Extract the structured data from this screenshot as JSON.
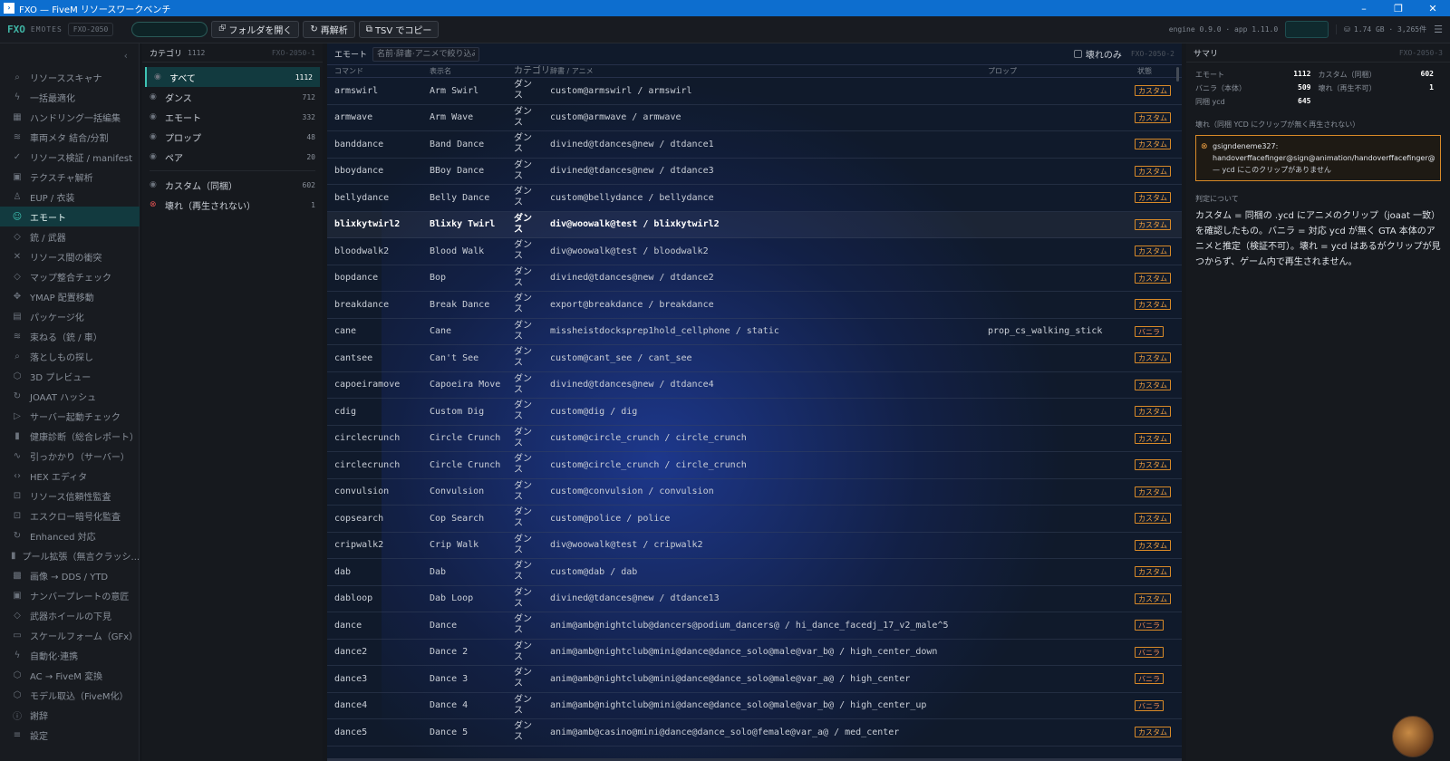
{
  "window": {
    "title": "FXO — FiveM リソースワークベンチ"
  },
  "toolbar": {
    "brand": "FXO",
    "section": "EMOTES",
    "code": "FXO-2050",
    "open_folder": "フォルダを開く",
    "reanalyze": "再解析",
    "copy_tsv": "TSV でコピー",
    "version": "engine 0.9.0 · app 1.11.0",
    "storage": "1.74 GB · 3,265件"
  },
  "sidebar": {
    "items": [
      {
        "label": "リソーススキャナ",
        "icon": "search-icon"
      },
      {
        "label": "一括最適化",
        "icon": "bolt-icon"
      },
      {
        "label": "ハンドリング一括編集",
        "icon": "grid-icon"
      },
      {
        "label": "車両メタ 結合/分割",
        "icon": "layers-icon"
      },
      {
        "label": "リソース検証 / manifest",
        "icon": "check-circle-icon"
      },
      {
        "label": "テクスチャ解析",
        "icon": "image-icon"
      },
      {
        "label": "EUP / 衣装",
        "icon": "user-icon"
      },
      {
        "label": "エモート",
        "icon": "emote-icon"
      },
      {
        "label": "銃 / 武器",
        "icon": "diamond-icon"
      },
      {
        "label": "リソース間の衝突",
        "icon": "cross-icon"
      },
      {
        "label": "マップ整合チェック",
        "icon": "diamond-icon"
      },
      {
        "label": "YMAP 配置移動",
        "icon": "move-icon"
      },
      {
        "label": "パッケージ化",
        "icon": "package-icon"
      },
      {
        "label": "束ねる（銃 / 車）",
        "icon": "layers-icon"
      },
      {
        "label": "落としもの探し",
        "icon": "search-icon"
      },
      {
        "label": "3D プレビュー",
        "icon": "cube-icon"
      },
      {
        "label": "JOAAT ハッシュ",
        "icon": "refresh-icon"
      },
      {
        "label": "サーバー起動チェック",
        "icon": "play-icon"
      },
      {
        "label": "健康診断（総合レポート）",
        "icon": "bar-chart-icon"
      },
      {
        "label": "引っかかり（サーバー）",
        "icon": "pulse-icon"
      },
      {
        "label": "HEX エディタ",
        "icon": "code-icon"
      },
      {
        "label": "リソース信頼性監査",
        "icon": "lock-icon"
      },
      {
        "label": "エスクロー暗号化監査",
        "icon": "lock-icon"
      },
      {
        "label": "Enhanced 対応",
        "icon": "refresh-icon"
      },
      {
        "label": "プール拡張（無言クラッシ...",
        "icon": "bar-chart-icon"
      },
      {
        "label": "画像 → DDS / YTD",
        "icon": "checker-icon"
      },
      {
        "label": "ナンバープレートの意匠",
        "icon": "image-icon"
      },
      {
        "label": "武器ホイールの下見",
        "icon": "diamond-icon"
      },
      {
        "label": "スケールフォーム（GFx）",
        "icon": "monitor-icon"
      },
      {
        "label": "自動化·連携",
        "icon": "bolt-icon"
      },
      {
        "label": "AC → FiveM 変換",
        "icon": "cube-icon"
      },
      {
        "label": "モデル取込（FiveM化）",
        "icon": "cube-icon"
      },
      {
        "label": "謝辞",
        "icon": "info-icon"
      },
      {
        "label": "設定",
        "icon": "sliders-icon"
      }
    ]
  },
  "categories": {
    "title": "カテゴリ",
    "count": "1112",
    "code": "FXO-2050-1",
    "items": [
      {
        "label": "すべて",
        "count": "1112"
      },
      {
        "label": "ダンス",
        "count": "712"
      },
      {
        "label": "エモート",
        "count": "332"
      },
      {
        "label": "プロップ",
        "count": "48"
      },
      {
        "label": "ペア",
        "count": "20"
      }
    ],
    "extra": [
      {
        "label": "カスタム（同梱）",
        "count": "602"
      },
      {
        "label": "壊れ（再生されない）",
        "count": "1"
      }
    ]
  },
  "emotes": {
    "title": "エモート",
    "filter_placeholder": "名前·辞書·アニメで絞り込み",
    "broken_only": "壊れのみ",
    "code": "FXO-2050-2",
    "columns": {
      "command": "コマンド",
      "display": "表示名",
      "category": "カテゴリ",
      "dict": "辞書 / アニメ",
      "prop": "プロップ",
      "status": "状態"
    },
    "rows": [
      {
        "command": "armswirl",
        "display": "Arm Swirl",
        "category": "ダンス",
        "dict": "custom@armswirl / armswirl",
        "prop": "",
        "status": "カスタム"
      },
      {
        "command": "armwave",
        "display": "Arm Wave",
        "category": "ダンス",
        "dict": "custom@armwave / armwave",
        "prop": "",
        "status": "カスタム"
      },
      {
        "command": "banddance",
        "display": "Band Dance",
        "category": "ダンス",
        "dict": "divined@tdances@new / dtdance1",
        "prop": "",
        "status": "カスタム"
      },
      {
        "command": "bboydance",
        "display": "BBoy Dance",
        "category": "ダンス",
        "dict": "divined@tdances@new / dtdance3",
        "prop": "",
        "status": "カスタム"
      },
      {
        "command": "bellydance",
        "display": "Belly Dance",
        "category": "ダンス",
        "dict": "custom@bellydance / bellydance",
        "prop": "",
        "status": "カスタム"
      },
      {
        "command": "blixkytwirl2",
        "display": "Blixky Twirl",
        "category": "ダンス",
        "dict": "div@woowalk@test / blixkytwirl2",
        "prop": "",
        "status": "カスタム"
      },
      {
        "command": "bloodwalk2",
        "display": "Blood Walk",
        "category": "ダンス",
        "dict": "div@woowalk@test / bloodwalk2",
        "prop": "",
        "status": "カスタム"
      },
      {
        "command": "bopdance",
        "display": "Bop",
        "category": "ダンス",
        "dict": "divined@tdances@new / dtdance2",
        "prop": "",
        "status": "カスタム"
      },
      {
        "command": "breakdance",
        "display": "Break Dance",
        "category": "ダンス",
        "dict": "export@breakdance / breakdance",
        "prop": "",
        "status": "カスタム"
      },
      {
        "command": "cane",
        "display": "Cane",
        "category": "ダンス",
        "dict": "missheistdocksprep1hold_cellphone / static",
        "prop": "prop_cs_walking_stick",
        "status": "バニラ"
      },
      {
        "command": "cantsee",
        "display": "Can't See",
        "category": "ダンス",
        "dict": "custom@cant_see / cant_see",
        "prop": "",
        "status": "カスタム"
      },
      {
        "command": "capoeiramove",
        "display": "Capoeira Move",
        "category": "ダンス",
        "dict": "divined@tdances@new / dtdance4",
        "prop": "",
        "status": "カスタム"
      },
      {
        "command": "cdig",
        "display": "Custom Dig",
        "category": "ダンス",
        "dict": "custom@dig / dig",
        "prop": "",
        "status": "カスタム"
      },
      {
        "command": "circlecrunch",
        "display": "Circle Crunch",
        "category": "ダンス",
        "dict": "custom@circle_crunch / circle_crunch",
        "prop": "",
        "status": "カスタム"
      },
      {
        "command": "circlecrunch",
        "display": "Circle Crunch",
        "category": "ダンス",
        "dict": "custom@circle_crunch / circle_crunch",
        "prop": "",
        "status": "カスタム"
      },
      {
        "command": "convulsion",
        "display": "Convulsion",
        "category": "ダンス",
        "dict": "custom@convulsion / convulsion",
        "prop": "",
        "status": "カスタム"
      },
      {
        "command": "copsearch",
        "display": "Cop Search",
        "category": "ダンス",
        "dict": "custom@police / police",
        "prop": "",
        "status": "カスタム"
      },
      {
        "command": "cripwalk2",
        "display": "Crip Walk",
        "category": "ダンス",
        "dict": "div@woowalk@test / cripwalk2",
        "prop": "",
        "status": "カスタム"
      },
      {
        "command": "dab",
        "display": "Dab",
        "category": "ダンス",
        "dict": "custom@dab / dab",
        "prop": "",
        "status": "カスタム"
      },
      {
        "command": "dabloop",
        "display": "Dab Loop",
        "category": "ダンス",
        "dict": "divined@tdances@new / dtdance13",
        "prop": "",
        "status": "カスタム"
      },
      {
        "command": "dance",
        "display": "Dance",
        "category": "ダンス",
        "dict": "anim@amb@nightclub@dancers@podium_dancers@ / hi_dance_facedj_17_v2_male^5",
        "prop": "",
        "status": "バニラ"
      },
      {
        "command": "dance2",
        "display": "Dance 2",
        "category": "ダンス",
        "dict": "anim@amb@nightclub@mini@dance@dance_solo@male@var_b@ / high_center_down",
        "prop": "",
        "status": "バニラ"
      },
      {
        "command": "dance3",
        "display": "Dance 3",
        "category": "ダンス",
        "dict": "anim@amb@nightclub@mini@dance@dance_solo@male@var_a@ / high_center",
        "prop": "",
        "status": "バニラ"
      },
      {
        "command": "dance4",
        "display": "Dance 4",
        "category": "ダンス",
        "dict": "anim@amb@nightclub@mini@dance@dance_solo@male@var_b@ / high_center_up",
        "prop": "",
        "status": "バニラ"
      },
      {
        "command": "dance5",
        "display": "Dance 5",
        "category": "ダンス",
        "dict": "anim@amb@casino@mini@dance@dance_solo@female@var_a@ / med_center",
        "prop": "",
        "status": "カスタム"
      }
    ]
  },
  "summary": {
    "title": "サマリ",
    "code": "FXO-2050-3",
    "stats": [
      [
        {
          "k": "エモート",
          "v": "1112"
        },
        {
          "k": "カスタム（同梱）",
          "v": "602"
        }
      ],
      [
        {
          "k": "バニラ（本体）",
          "v": "509"
        },
        {
          "k": "壊れ（再生不可）",
          "v": "1"
        }
      ],
      [
        {
          "k": "同梱 ycd",
          "v": "645"
        },
        {
          "k": "",
          "v": ""
        }
      ]
    ],
    "broken_heading": "壊れ（同梱 YCD にクリップが無く再生されない）",
    "broken_item": {
      "name": "gsigndeneme327:",
      "dict": "handoverffacefinger@sign@animation/handoverffacefinger@si",
      "note": "— ycd にこのクリップがありません"
    },
    "judge_heading": "判定について",
    "judge_text": "カスタム = 同梱の .ycd にアニメのクリップ（joaat 一致）を確認したもの。バニラ = 対応 ycd が無く GTA 本体のアニメと推定（検証不可）。壊れ = ycd はあるがクリップが見つからず、ゲーム内で再生されません。"
  },
  "colors": {
    "accent": "#3fc4b4",
    "warning": "#f0a040",
    "titlebar": "#0d6ecf"
  }
}
